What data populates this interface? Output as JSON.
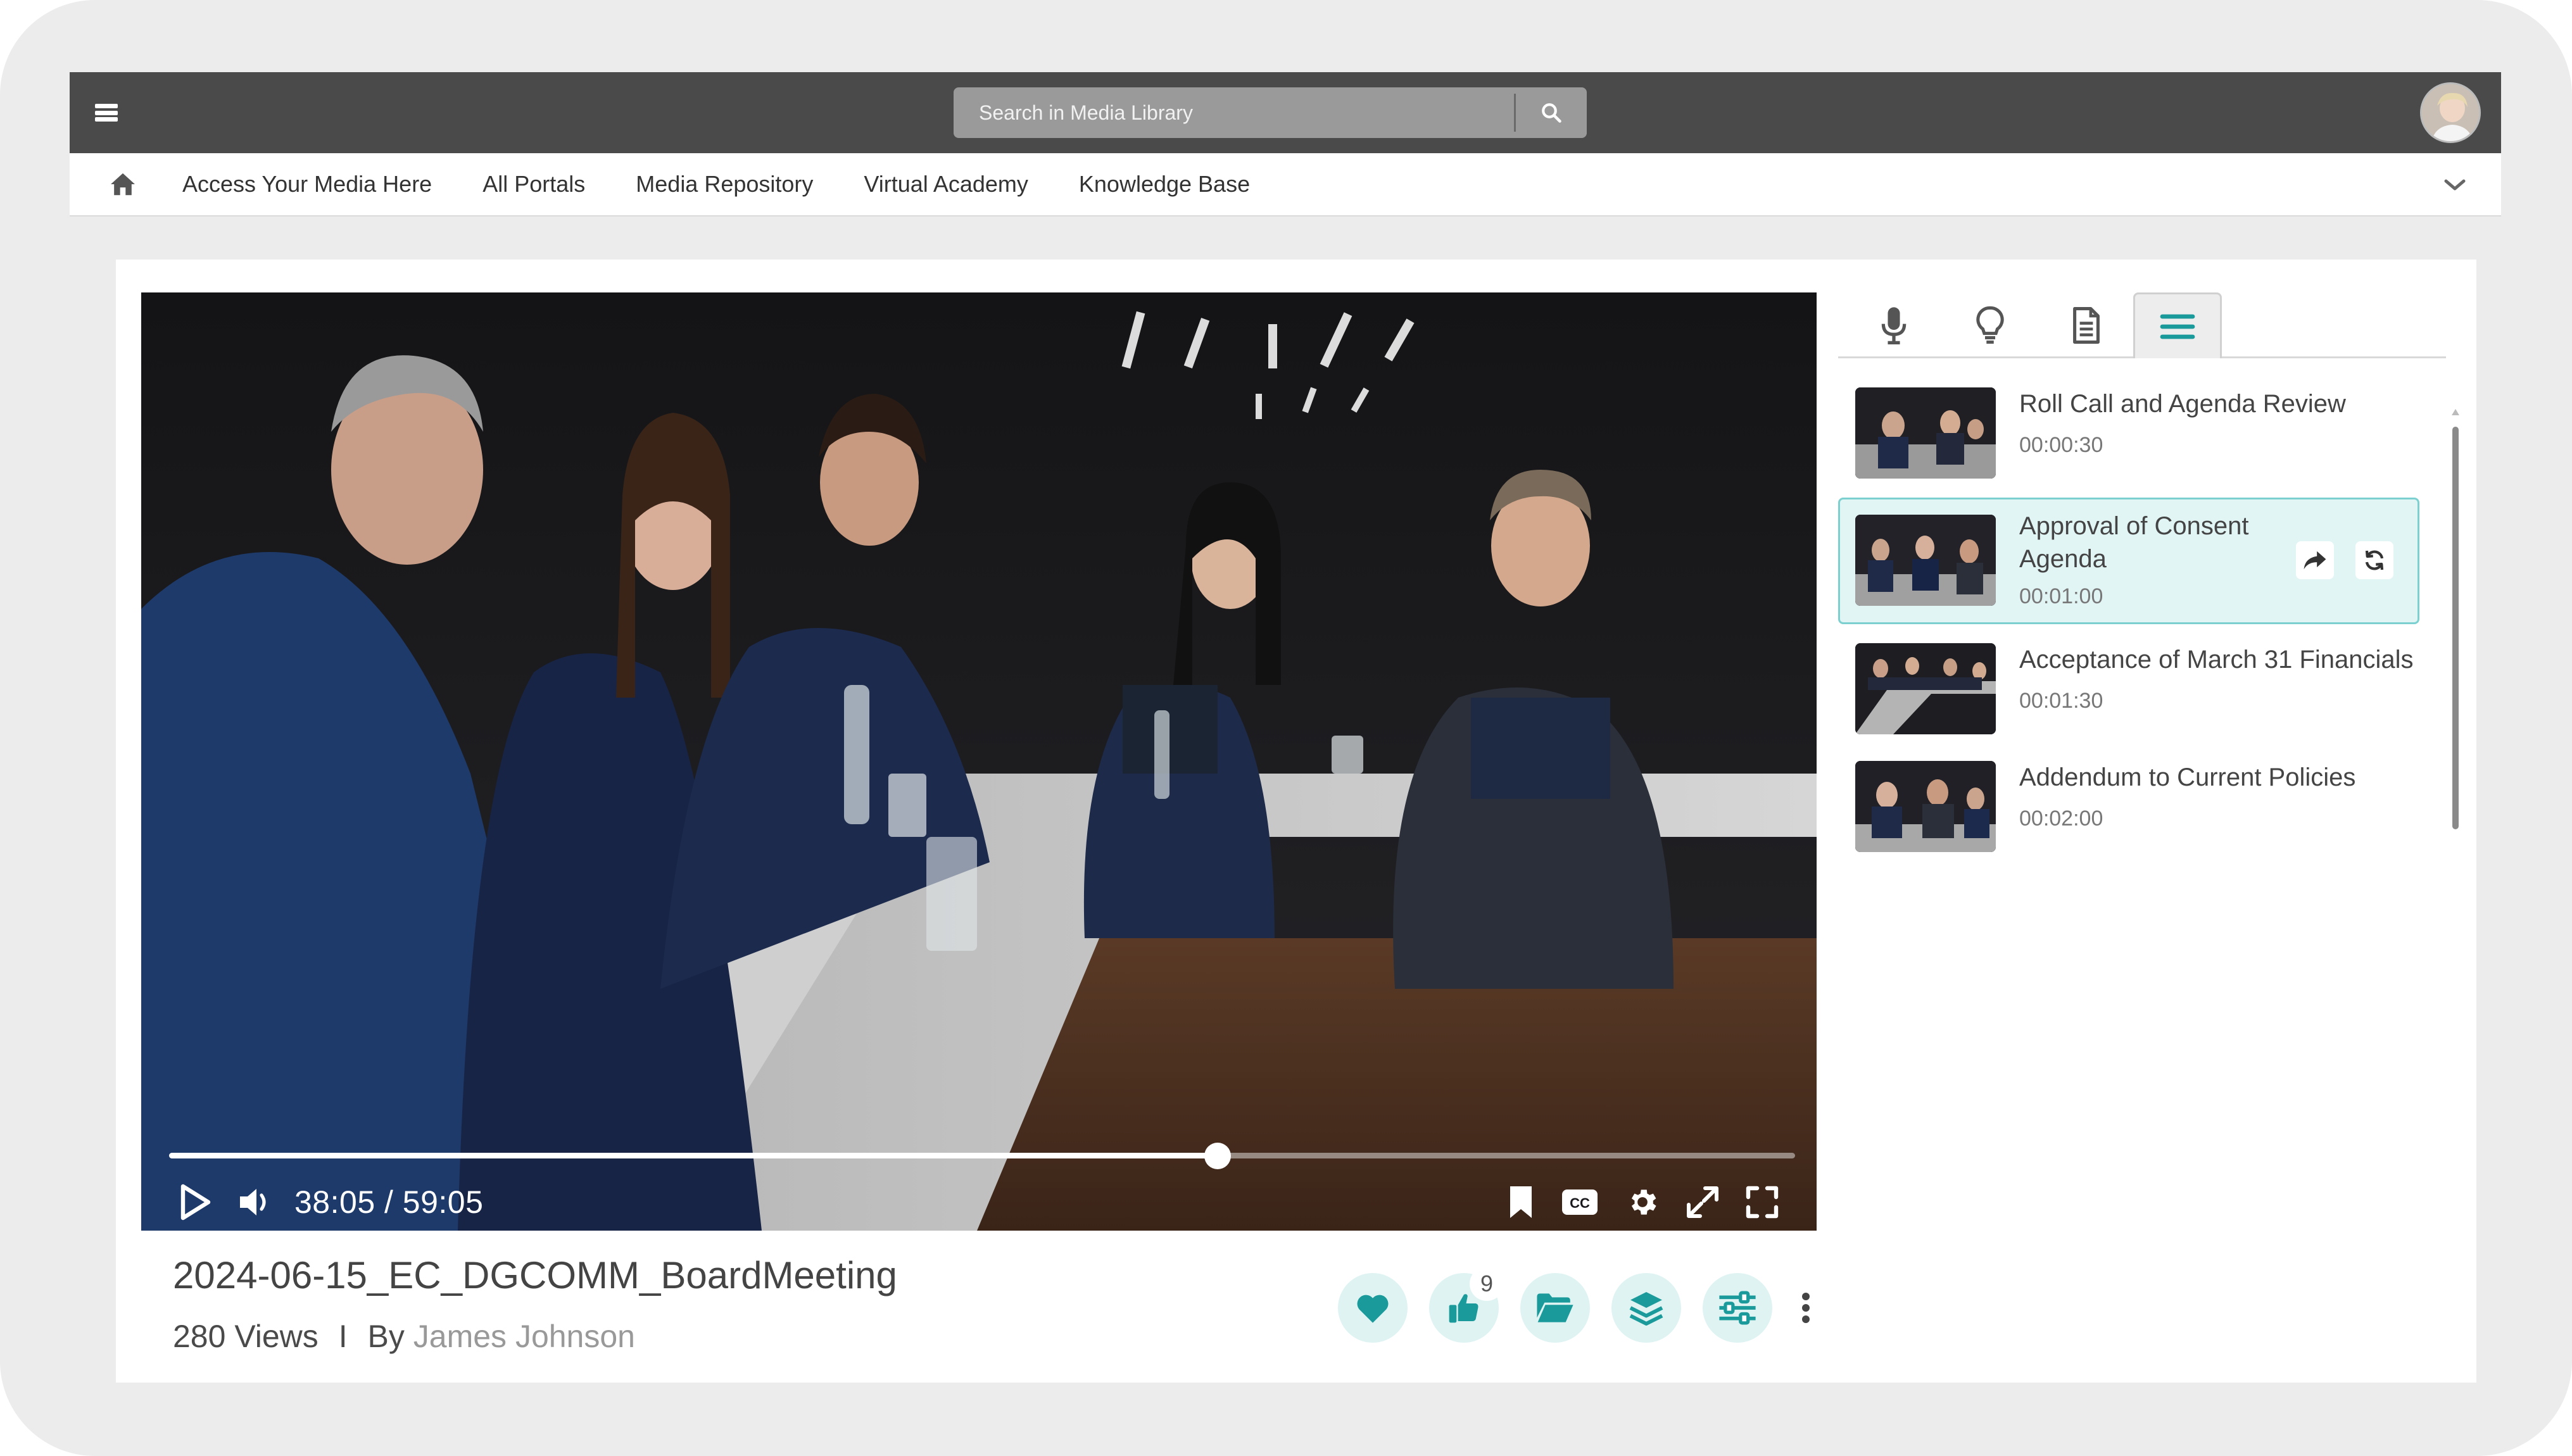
{
  "search": {
    "placeholder": "Search in Media Library"
  },
  "nav": {
    "items": [
      {
        "label": "Access Your Media Here"
      },
      {
        "label": "All Portals"
      },
      {
        "label": "Media Repository"
      },
      {
        "label": "Virtual Academy"
      },
      {
        "label": "Knowledge Base"
      }
    ]
  },
  "player": {
    "current_time": "38:05",
    "duration": "59:05",
    "time_display": "38:05 / 59:05",
    "progress": 0.645
  },
  "media": {
    "title": "2024-06-15_EC_DGCOMM_BoardMeeting",
    "views": "280 Views",
    "separator": "I",
    "by": "By",
    "author": "James Johnson",
    "like_count": "9"
  },
  "side_tabs": [
    "microphone-icon",
    "lightbulb-icon",
    "document-icon",
    "list-icon"
  ],
  "chapters": [
    {
      "title": "Roll Call and Agenda Review",
      "time": "00:00:30",
      "active": false
    },
    {
      "title": "Approval of Consent Agenda",
      "time": "00:01:00",
      "active": true
    },
    {
      "title": "Acceptance of March 31 Financials",
      "time": "00:01:30",
      "active": false
    },
    {
      "title": "Addendum to Current Policies",
      "time": "00:02:00",
      "active": false
    }
  ],
  "colors": {
    "accent": "#1a9a9a",
    "accent_light": "#dff3f3",
    "topbar": "#4a4a4a"
  }
}
